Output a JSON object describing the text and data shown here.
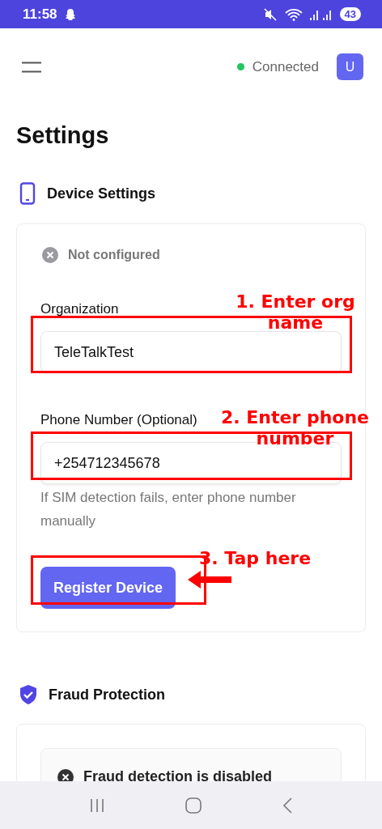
{
  "status_bar": {
    "time": "11:58",
    "battery": "43"
  },
  "header": {
    "connection": {
      "label": "Connected",
      "color": "#22c55e"
    },
    "avatar": "U"
  },
  "title": "Settings",
  "sections": [
    {
      "kind": "device",
      "title": "Device Settings",
      "status": "Not configured",
      "fields": [
        {
          "label": "Organization",
          "value": "TeleTalkTest"
        },
        {
          "label": "Phone Number (Optional)",
          "value": "+254712345678",
          "hint": "If SIM detection fails, enter phone number manually"
        }
      ],
      "button": "Register Device"
    },
    {
      "kind": "fraud",
      "title": "Fraud Protection",
      "notice": "Fraud detection is disabled"
    }
  ],
  "annotations": [
    {
      "kind": "box",
      "text": "1. Enter org name"
    },
    {
      "kind": "box",
      "text": "2. Enter phone number"
    },
    {
      "kind": "arrow",
      "text": "3. Tap here"
    }
  ]
}
